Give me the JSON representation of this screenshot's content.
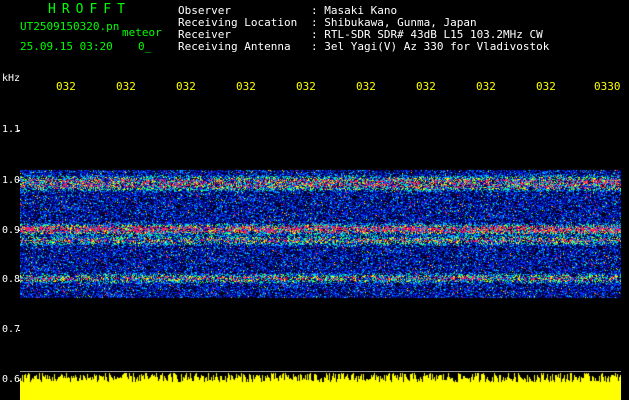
{
  "header": {
    "app_title": "HROFFT",
    "file_name": "UT2509150320.pn",
    "mode": "meteor",
    "datetime": "25.09.15 03:20",
    "datetime_value": "0_"
  },
  "station_info": [
    {
      "label": "Observer",
      "value": ": Masaki Kano"
    },
    {
      "label": "Receiving Location",
      "value": ": Shibukawa, Gunma, Japan"
    },
    {
      "label": "Receiver",
      "value": ": RTL-SDR SDR# 43dB L15 103.2MHz CW"
    },
    {
      "label": "Receiving Antenna",
      "value": ": 3el Yagi(V) Az 330 for Vladivostok"
    }
  ],
  "axis": {
    "unit": "kHz",
    "y_ticks": [
      "1.1",
      "1.0",
      "0.9",
      "0.8",
      "0.7",
      "0.6"
    ],
    "x_ticks": [
      "032",
      "032",
      "032",
      "032",
      "032",
      "032",
      "032",
      "032",
      "032",
      "0330"
    ]
  },
  "colors": {
    "header_green": "#00ff00",
    "info_white": "#ffffff",
    "tick_yellow": "#ffff00",
    "axis_white": "#ffffff",
    "background": "#000000"
  }
}
